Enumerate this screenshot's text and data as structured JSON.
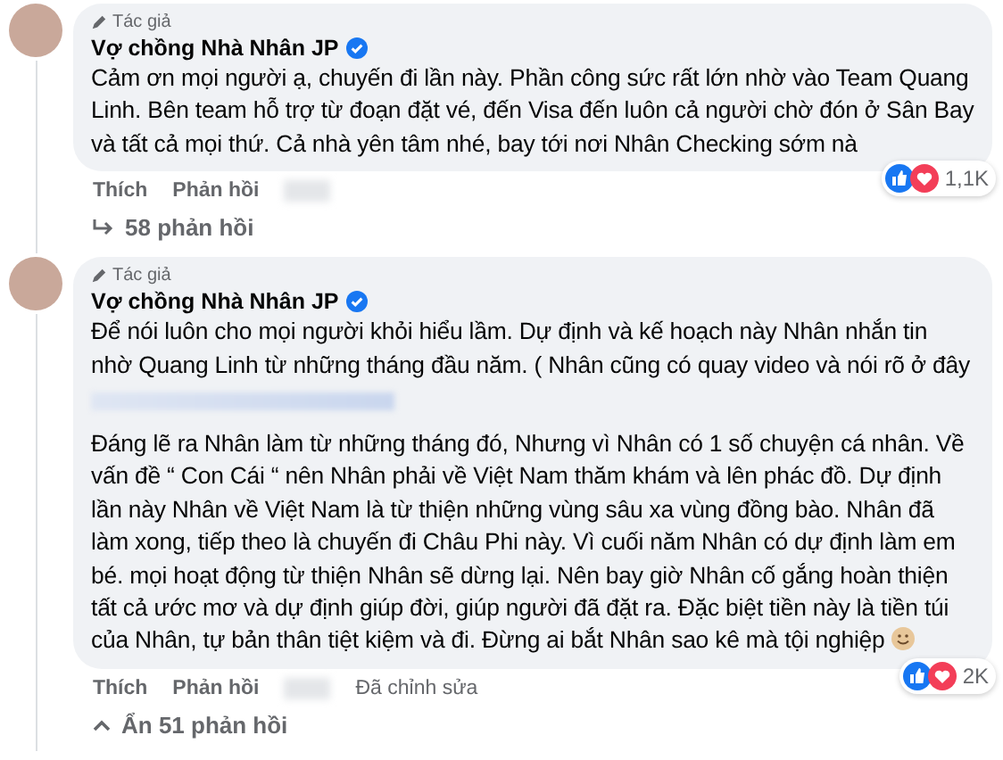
{
  "comments": [
    {
      "author_badge": "Tác giả",
      "author": "Vợ chồng Nhà Nhân JP",
      "verified": true,
      "paragraphs": [
        "Cảm ơn mọi người ạ, chuyến đi lần này. Phần công sức rất lớn nhờ vào Team Quang Linh. Bên team hỗ trợ từ đoạn đặt vé, đến Visa đến luôn cả người chờ đón ở Sân Bay và tất cả mọi thứ. Cả nhà yên tâm nhé, bay tới nơi Nhân Checking sớm nà"
      ],
      "actions": [
        "Thích",
        "Phản hồi"
      ],
      "reaction_count": "1,1K",
      "replies": {
        "label": "58 phản hồi",
        "expanded": false
      }
    },
    {
      "author_badge": "Tác giả",
      "author": "Vợ chồng Nhà Nhân JP",
      "verified": true,
      "paragraphs": [
        "Để nói luôn cho mọi người khỏi hiểu lầm. Dự định và kế hoạch này Nhân nhắn tin nhờ Quang Linh từ những tháng đầu năm. ( Nhân cũng có quay video và nói rõ ở đây",
        "Đáng lẽ ra Nhân làm từ những tháng đó, Nhưng vì Nhân có 1 số chuyện cá nhân. Về vấn đề “ Con Cái “ nên Nhân phải về Việt Nam thăm khám và lên phác đồ. Dự định lần này Nhân về Việt Nam là từ thiện những vùng sâu xa vùng đồng bào. Nhân đã làm xong, tiếp theo là chuyến đi Châu Phi này. Vì cuối năm Nhân có dự định làm em bé. mọi hoạt động từ thiện Nhân sẽ dừng lại. Nên bay giờ Nhân cố gắng hoàn thiện tất cả ước mơ và dự định giúp đời, giúp người đã đặt ra. Đặc biệt tiền này là tiền túi của Nhân, tự bản thân tiệt kiệm và đi. Đừng ai bắt Nhân sao kê mà tội nghiệp"
      ],
      "blurred_link": true,
      "ends_with_emoji": true,
      "actions": [
        "Thích",
        "Phản hồi"
      ],
      "edited": "Đã chỉnh sửa",
      "reaction_count": "2K",
      "replies": {
        "label": "Ẩn 51 phản hồi",
        "expanded": true
      }
    }
  ]
}
